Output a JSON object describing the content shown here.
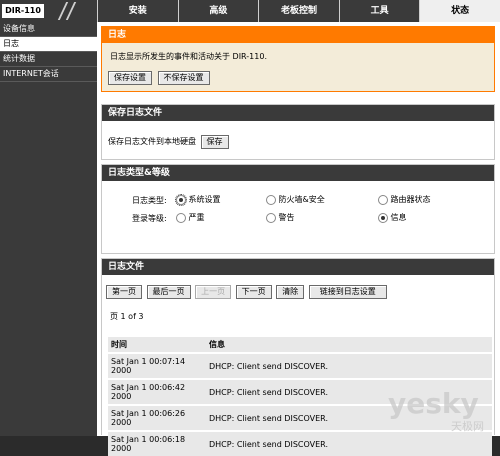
{
  "header": {
    "model": "DIR-110",
    "tabs": [
      "安装",
      "高级",
      "老板控制",
      "工具",
      "状态"
    ],
    "active_tab": 4
  },
  "sidebar": {
    "items": [
      {
        "label": "设备信息"
      },
      {
        "label": "日志"
      },
      {
        "label": "统计数据"
      },
      {
        "label": "INTERNET会话"
      }
    ]
  },
  "log_section": {
    "title": "日志",
    "description": "日志显示所发生的事件和活动关于 DIR-110.",
    "save_settings": "保存设置",
    "dont_save": "不保存设置"
  },
  "save_log_section": {
    "title": "保存日志文件",
    "label": "保存日志文件到本地硬盘",
    "save_button": "保存"
  },
  "log_type_section": {
    "title": "日志类型&等级",
    "type_label": "日志类型:",
    "level_label": "登录等级:",
    "types": [
      "系统设置",
      "防火墙&安全",
      "路由器状态"
    ],
    "levels": [
      "严重",
      "警告",
      "信息"
    ]
  },
  "log_files_section": {
    "title": "日志文件",
    "buttons": [
      "第一页",
      "最后一页",
      "上一页",
      "下一页",
      "清除",
      "链接到日志设置"
    ],
    "page_info": "页 1 of 3",
    "col_time": "时间",
    "col_info": "信息",
    "rows": [
      {
        "time_line1": "Sat Jan 1 00:07:14",
        "time_line2": "2000",
        "info": "DHCP: Client send DISCOVER."
      },
      {
        "time_line1": "Sat Jan 1 00:06:42",
        "time_line2": "2000",
        "info": "DHCP: Client send DISCOVER."
      },
      {
        "time_line1": "Sat Jan 1 00:06:26",
        "time_line2": "2000",
        "info": "DHCP: Client send DISCOVER."
      },
      {
        "time_line1": "Sat Jan 1 00:06:18",
        "time_line2": "2000",
        "info": "DHCP: Client send DISCOVER."
      }
    ]
  },
  "watermark": {
    "main": "yesky",
    "sub": "天极网"
  },
  "colors": {
    "orange": "#ff7a00",
    "dark": "#3a3a3a"
  }
}
